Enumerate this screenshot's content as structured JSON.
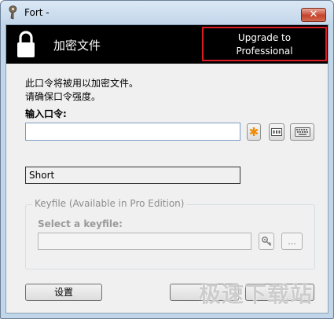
{
  "window": {
    "title": "Fort -",
    "close_label": "✕"
  },
  "banner": {
    "title": "加密文件",
    "upgrade_line1": "Upgrade to",
    "upgrade_line2": "Professional"
  },
  "description": {
    "line1": "此口令将被用以加密文件。",
    "line2": "请确保口令强度。"
  },
  "password": {
    "label": "输入口令:",
    "value": "",
    "placeholder": ""
  },
  "icons": {
    "generate": "asterisk-icon",
    "show": "text-field-icon",
    "keyboard": "keyboard-icon"
  },
  "strength": {
    "value": "Short"
  },
  "keyfile": {
    "legend": "Keyfile (Available in Pro Edition)",
    "label": "Select a keyfile:",
    "value": "",
    "browse_label": "..."
  },
  "buttons": {
    "settings": "设置",
    "ok": "",
    "cancel": ""
  },
  "watermark": "极速下载站",
  "colors": {
    "banner_bg": "#000000",
    "upgrade_border": "#d81c22",
    "generate_icon": "#f08a00"
  }
}
